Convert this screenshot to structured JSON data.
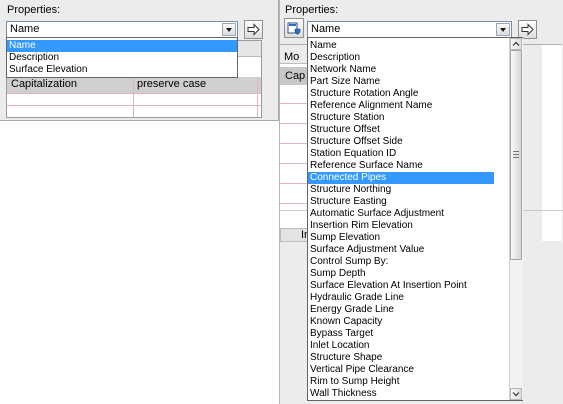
{
  "left": {
    "properties_label": "Properties:",
    "combo_value": "Name",
    "options": [
      "Name",
      "Description",
      "Surface Elevation"
    ],
    "selected_index": 0,
    "row_cells": [
      "Capitalization",
      "preserve case"
    ]
  },
  "right": {
    "properties_label": "Properties:",
    "combo_value": "Name",
    "peek_header": "Mo",
    "peek_row": "Cap",
    "peek_bottom": "In",
    "selected_index": 11,
    "options": [
      "Name",
      "Description",
      "Network Name",
      "Part Size Name",
      "Structure Rotation Angle",
      "Reference Alignment Name",
      "Structure Station",
      "Structure Offset",
      "Structure Offset Side",
      "Station Equation ID",
      "Reference Surface Name",
      "Connected Pipes",
      "Structure Northing",
      "Structure Easting",
      "Automatic Surface Adjustment",
      "Insertion Rim Elevation",
      "Sump Elevation",
      "Surface Adjustment Value",
      "Control Sump By:",
      "Sump Depth",
      "Surface Elevation At Insertion Point",
      "Hydraulic Grade Line",
      "Energy Grade Line",
      "Known Capacity",
      "Bypass Target",
      "Inlet Location",
      "Structure Shape",
      "Vertical Pipe Clearance",
      "Rim to Sump Height",
      "Wall Thickness"
    ]
  },
  "icons": {
    "insert": "insert-arrow-icon",
    "field": "field-picker-icon",
    "dropdown": "chevron-down-icon"
  }
}
